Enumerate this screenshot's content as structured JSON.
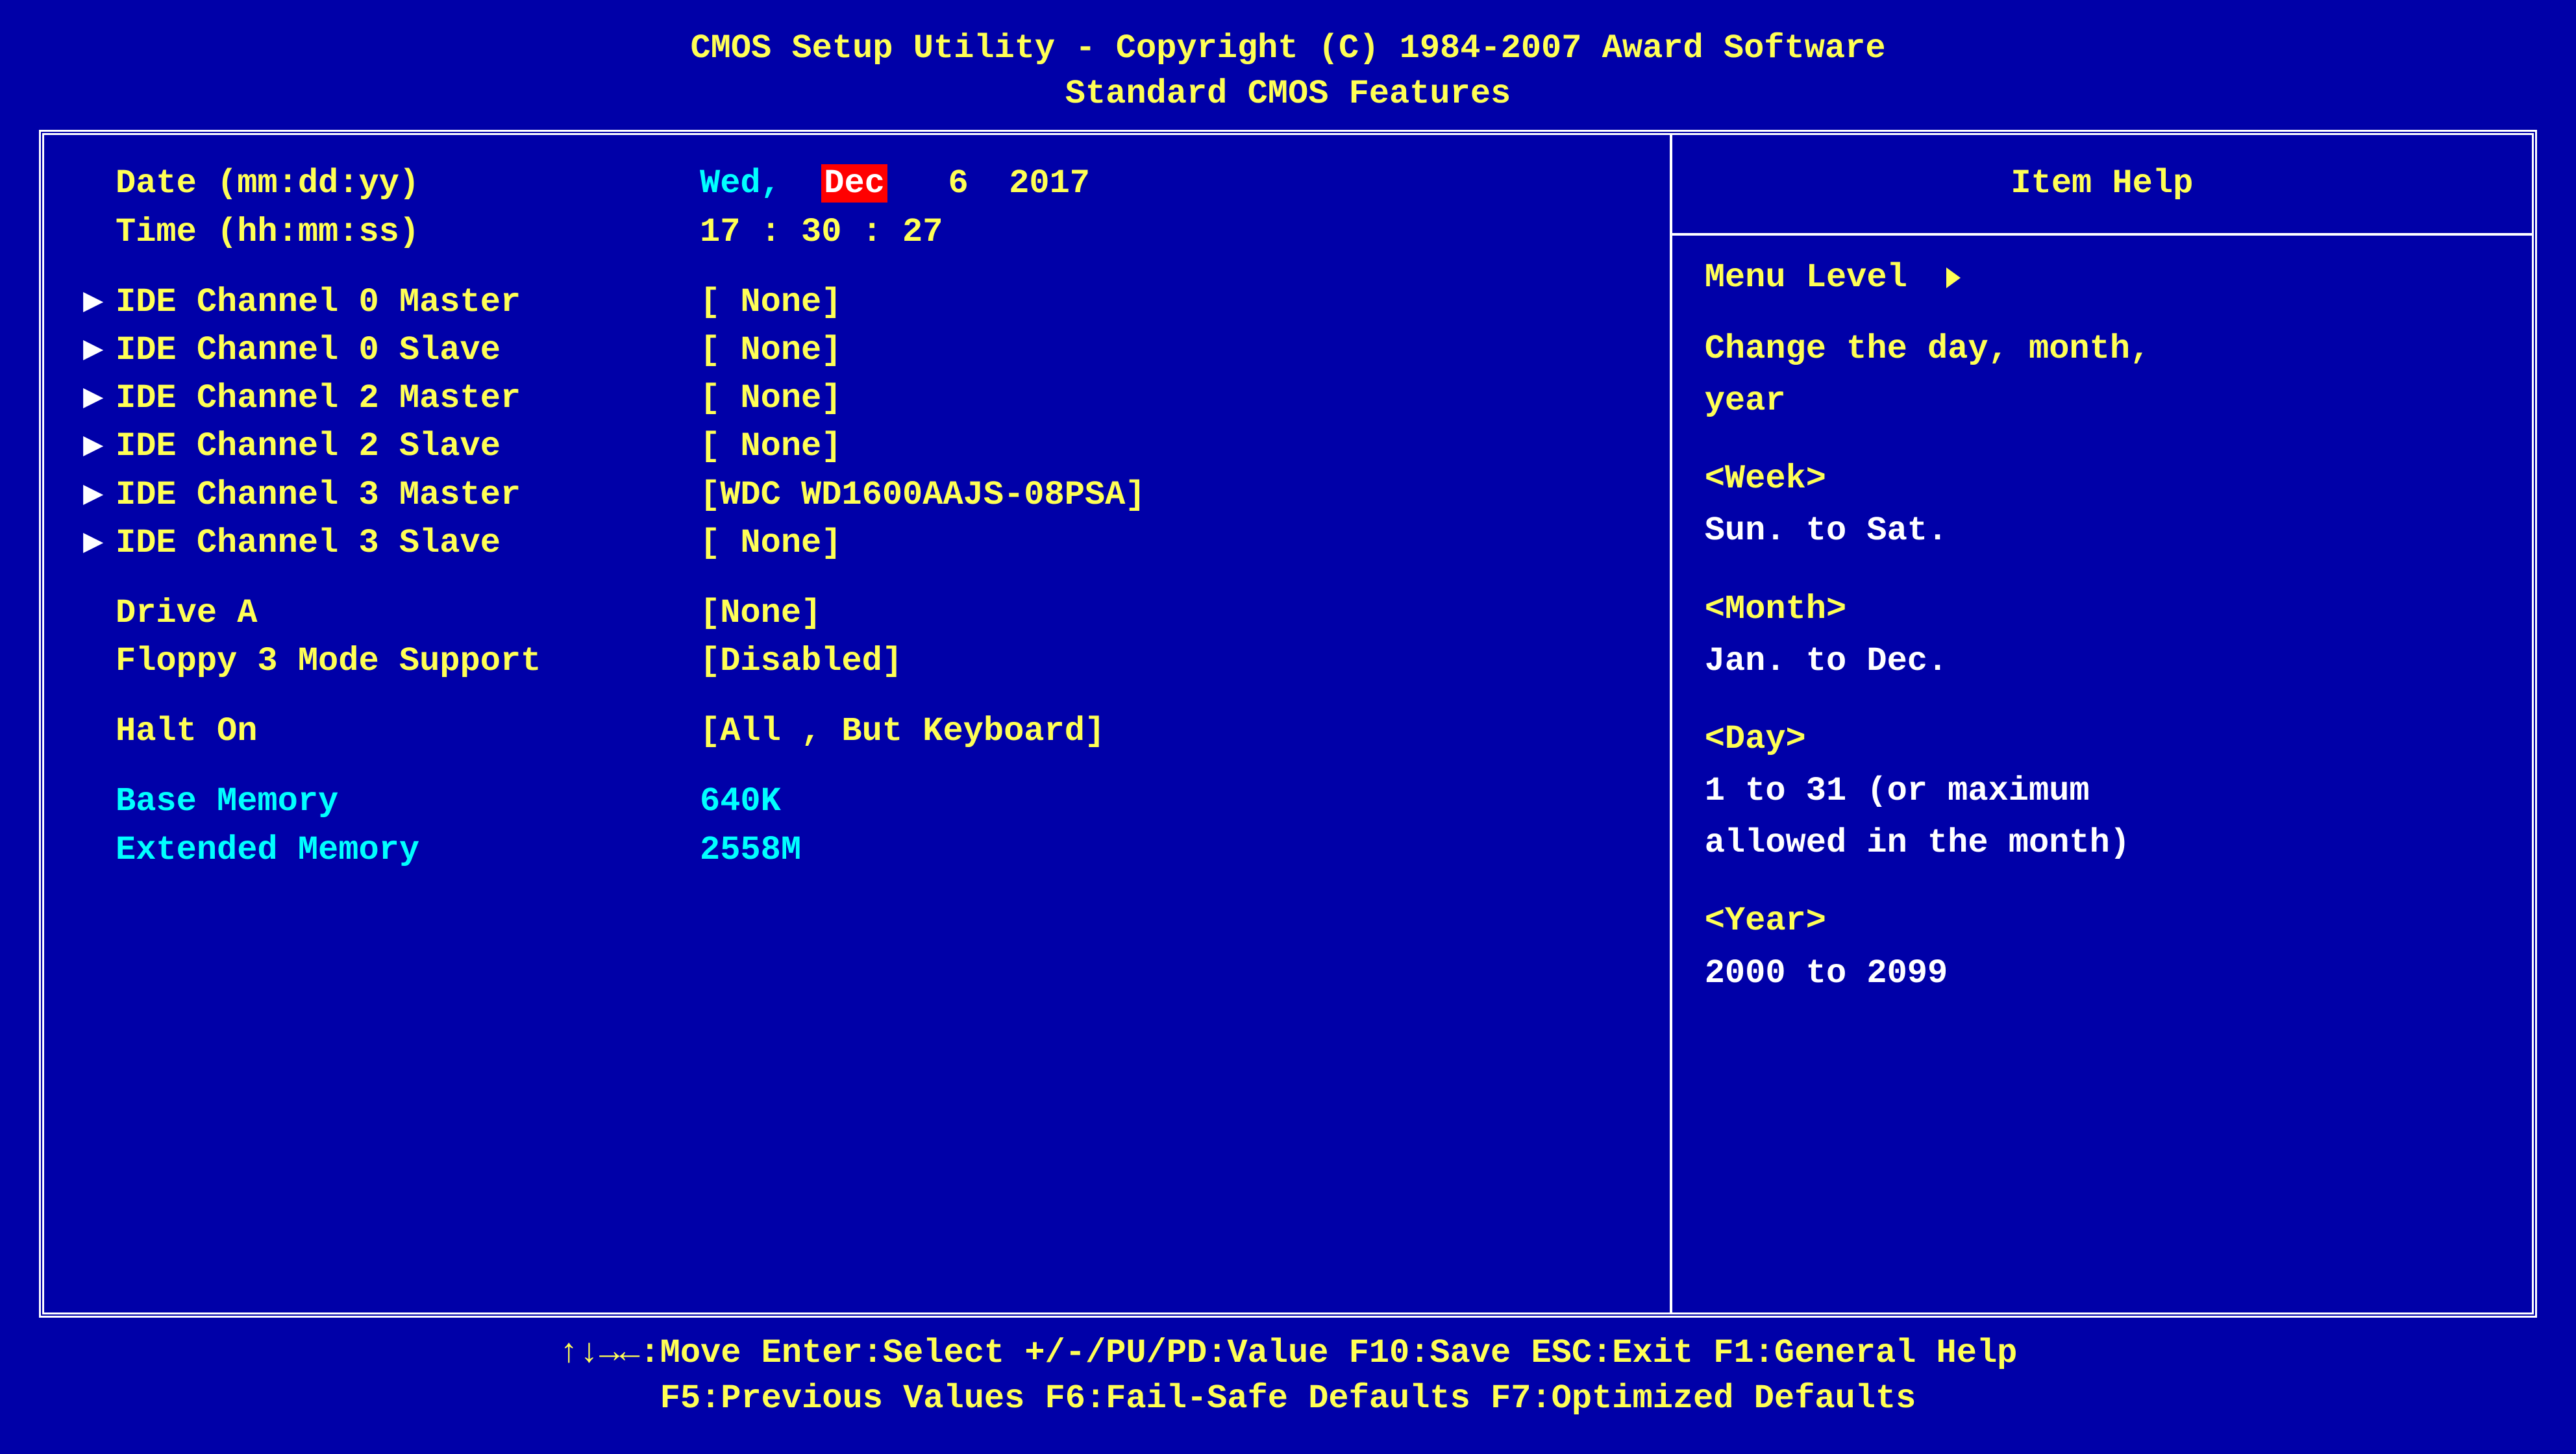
{
  "header": {
    "line1": "CMOS Setup Utility - Copyright (C) 1984-2007 Award Software",
    "line2": "Standard CMOS Features"
  },
  "main": {
    "date_label": "Date (mm:dd:yy)",
    "date_weekday": "Wed,",
    "date_month": "Dec",
    "date_day": " 6",
    "date_year": "2017",
    "time_label": "Time (hh:mm:ss)",
    "time_value": "17 : 30 : 27",
    "ide": [
      {
        "label": "IDE Channel 0 Master",
        "value": "[ None]"
      },
      {
        "label": "IDE Channel 0 Slave",
        "value": "[ None]"
      },
      {
        "label": "IDE Channel 2 Master",
        "value": "[ None]"
      },
      {
        "label": "IDE Channel 2 Slave",
        "value": "[ None]"
      },
      {
        "label": "IDE Channel 3 Master",
        "value": "[WDC WD1600AAJS-08PSA]"
      },
      {
        "label": "IDE Channel 3 Slave",
        "value": "[ None]"
      }
    ],
    "drive_a_label": "Drive A",
    "drive_a_value": "[None]",
    "floppy_label": "Floppy 3 Mode Support",
    "floppy_value": "[Disabled]",
    "halt_label": "Halt On",
    "halt_value": "[All , But Keyboard]",
    "base_mem_label": "Base Memory",
    "base_mem_value": " 640K",
    "ext_mem_label": "Extended Memory",
    "ext_mem_value": "2558M"
  },
  "help": {
    "title": "Item Help",
    "menu_level": "Menu Level",
    "desc1": "Change the day, month,",
    "desc2": "year",
    "week_h": "<Week>",
    "week_t": "Sun. to Sat.",
    "month_h": "<Month>",
    "month_t": "Jan. to Dec.",
    "day_h": "<Day>",
    "day_t1": "1 to 31 (or maximum",
    "day_t2": "allowed in the month)",
    "year_h": "<Year>",
    "year_t": "2000 to 2099"
  },
  "footer": {
    "line1": "↑↓→←:Move  Enter:Select  +/-/PU/PD:Value  F10:Save  ESC:Exit  F1:General Help",
    "line2": "F5:Previous Values  F6:Fail-Safe Defaults  F7:Optimized Defaults"
  }
}
